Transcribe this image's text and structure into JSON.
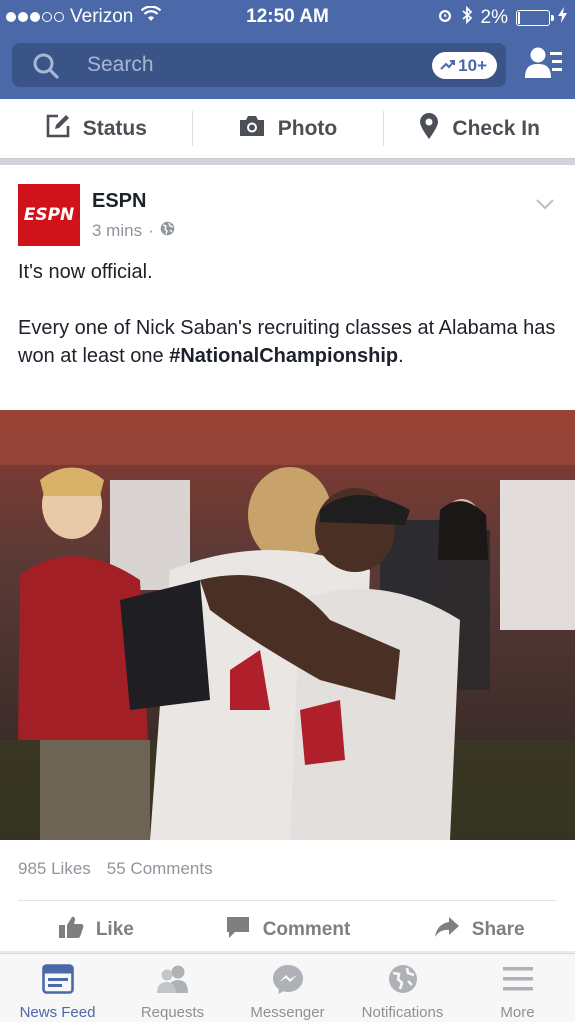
{
  "status_bar": {
    "carrier": "Verizon",
    "time": "12:50 AM",
    "battery": "2%"
  },
  "search": {
    "placeholder": "Search",
    "trending_badge": "10+"
  },
  "composer": {
    "status_label": "Status",
    "photo_label": "Photo",
    "checkin_label": "Check In"
  },
  "post": {
    "logo_text": "ESPN",
    "author": "ESPN",
    "time": "3 mins",
    "separator": "·",
    "text_line1": "It's now official.",
    "text_line2": "Every one of Nick Saban's recruiting classes at Alabama has won at least one ",
    "hashtag": "#NationalChampionship",
    "text_end": ".",
    "likes": "985 Likes",
    "comments": "55 Comments",
    "actions": {
      "like": "Like",
      "comment": "Comment",
      "share": "Share"
    }
  },
  "tabs": [
    {
      "label": "News Feed",
      "icon": "news-feed-icon",
      "active": true
    },
    {
      "label": "Requests",
      "icon": "requests-icon",
      "active": false
    },
    {
      "label": "Messenger",
      "icon": "messenger-icon",
      "active": false
    },
    {
      "label": "Notifications",
      "icon": "notifications-icon",
      "active": false
    },
    {
      "label": "More",
      "icon": "more-icon",
      "active": false
    }
  ],
  "colors": {
    "brand_blue": "#4b69a9",
    "espn_red": "#d0121b",
    "muted_text": "#90949c"
  }
}
